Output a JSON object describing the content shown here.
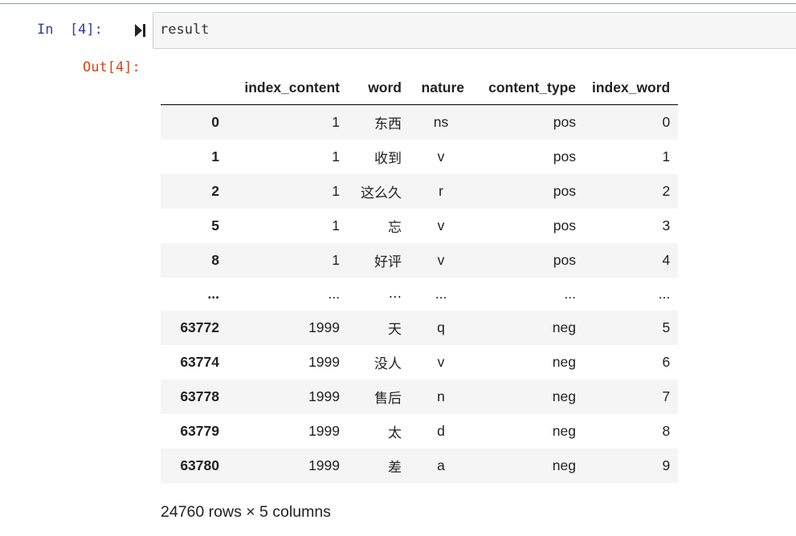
{
  "cell": {
    "in_prompt": "In  [4]:",
    "out_prompt": "Out[4]:",
    "code": "result"
  },
  "colors": {
    "top_rule": "#66bb6a",
    "in_prompt": "#303f9f",
    "out_prompt": "#d84315",
    "row_stripe": "#f5f5f5"
  },
  "icons": {
    "run": "run-cell-icon"
  },
  "dataframe": {
    "columns": [
      "index_content",
      "word",
      "nature",
      "content_type",
      "index_word"
    ],
    "rows": [
      {
        "index": "0",
        "index_content": "1",
        "word": "东西",
        "nature": "ns",
        "content_type": "pos",
        "index_word": "0"
      },
      {
        "index": "1",
        "index_content": "1",
        "word": "收到",
        "nature": "v",
        "content_type": "pos",
        "index_word": "1"
      },
      {
        "index": "2",
        "index_content": "1",
        "word": "这么久",
        "nature": "r",
        "content_type": "pos",
        "index_word": "2"
      },
      {
        "index": "5",
        "index_content": "1",
        "word": "忘",
        "nature": "v",
        "content_type": "pos",
        "index_word": "3"
      },
      {
        "index": "8",
        "index_content": "1",
        "word": "好评",
        "nature": "v",
        "content_type": "pos",
        "index_word": "4"
      },
      {
        "index": "...",
        "index_content": "...",
        "word": "...",
        "nature": "...",
        "content_type": "...",
        "index_word": "..."
      },
      {
        "index": "63772",
        "index_content": "1999",
        "word": "天",
        "nature": "q",
        "content_type": "neg",
        "index_word": "5"
      },
      {
        "index": "63774",
        "index_content": "1999",
        "word": "没人",
        "nature": "v",
        "content_type": "neg",
        "index_word": "6"
      },
      {
        "index": "63778",
        "index_content": "1999",
        "word": "售后",
        "nature": "n",
        "content_type": "neg",
        "index_word": "7"
      },
      {
        "index": "63779",
        "index_content": "1999",
        "word": "太",
        "nature": "d",
        "content_type": "neg",
        "index_word": "8"
      },
      {
        "index": "63780",
        "index_content": "1999",
        "word": "差",
        "nature": "a",
        "content_type": "neg",
        "index_word": "9"
      }
    ],
    "shape": "24760 rows × 5 columns"
  }
}
